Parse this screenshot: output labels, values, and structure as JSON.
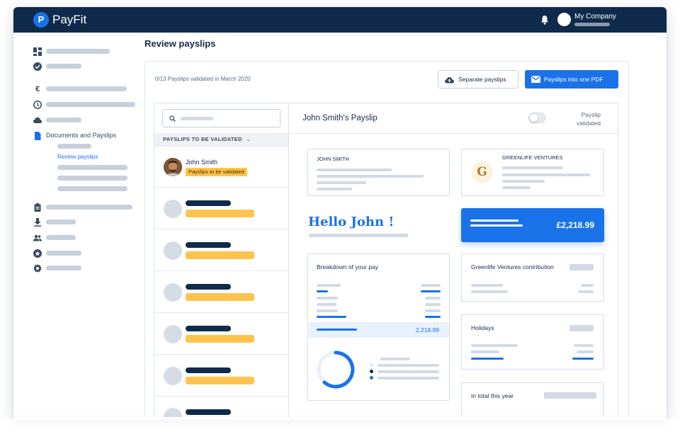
{
  "app": {
    "name": "PayFit",
    "logo_glyph": "P",
    "company_name": "My Company",
    "icons": {
      "notifications": "bell-icon",
      "company": "company-avatar"
    }
  },
  "sidebar": {
    "items": [
      {
        "icon": "dashboard-icon",
        "label": ""
      },
      {
        "icon": "check-circle-icon",
        "label": ""
      },
      {
        "icon": "euro-icon",
        "label": ""
      },
      {
        "icon": "clock-icon",
        "label": ""
      },
      {
        "icon": "cloud-icon",
        "label": ""
      },
      {
        "icon": "document-icon",
        "label": "Documents and Payslips",
        "active": true,
        "subitems": [
          {
            "label": ""
          },
          {
            "label": "Review payslips",
            "active": true
          },
          {
            "label": ""
          },
          {
            "label": ""
          },
          {
            "label": ""
          }
        ]
      },
      {
        "icon": "clipboard-icon",
        "label": ""
      },
      {
        "icon": "download-icon",
        "label": ""
      },
      {
        "icon": "people-icon",
        "label": ""
      },
      {
        "icon": "star-badge-icon",
        "label": ""
      },
      {
        "icon": "gear-icon",
        "label": ""
      }
    ]
  },
  "main": {
    "title": "Review payslips",
    "status": "0/13 Payslips validated in March 2020",
    "actions": {
      "separate_label": "Separate payslips",
      "separate_icon": "cloud-upload-icon",
      "merge_label": "Payslips into one PDF",
      "merge_icon": "mail-icon"
    },
    "list": {
      "search_placeholder": "",
      "section_header": "PAYSLIPS TO BE VALIDATED",
      "selected": {
        "name": "John Smith",
        "badge": "Payslips to be validated"
      },
      "placeholder_rows": 6
    },
    "detail": {
      "title": "John Smith's Payslip",
      "toggle_label": "Payslip validated",
      "toggle_on": false,
      "employee_card": "JOHN SMITH",
      "company_card": "GREENLIFE VENTURES",
      "company_logo": "G",
      "greeting": "Hello John !",
      "net_amount": "£2,218.99",
      "breakdown_title": "Breakdown of your pay",
      "breakdown_total": "2,218.99",
      "contribution_title": "Greenlife Ventures contribution",
      "holidays_title": "Holidays",
      "year_total_title": "In total this year"
    }
  },
  "colors": {
    "brand_navy": "#0f2a4a",
    "accent_blue": "#1a72e8",
    "badge_yellow": "#ffc44d",
    "placeholder_gray": "#c8d0dc"
  }
}
